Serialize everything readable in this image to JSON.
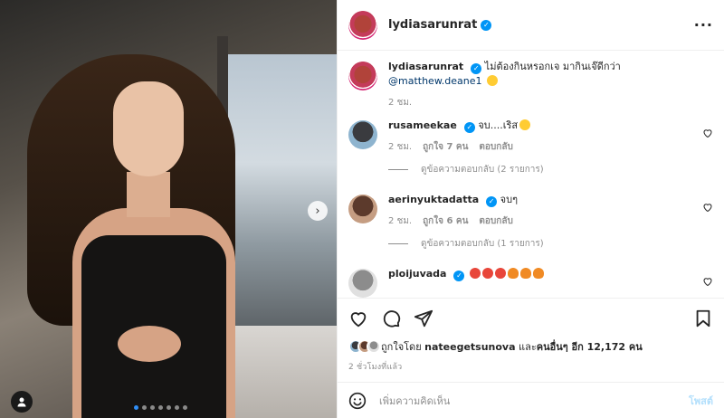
{
  "post": {
    "username": "lydiasarunrat",
    "caption": {
      "username": "lydiasarunrat",
      "text": "ไม่ต้องกินหรอกเจ มากินเจ๊ดีกว่า",
      "mention": "@matthew.deane1",
      "time": "2 ชม."
    },
    "comments": [
      {
        "username": "rusameekae",
        "text": "จบ....เริส",
        "time": "2 ชม.",
        "likes": "ถูกใจ 7 คน",
        "reply_label": "ตอบกลับ",
        "view_replies": "ดูข้อความตอบกลับ (2 รายการ)"
      },
      {
        "username": "aerinyuktadatta",
        "text": "จบๆ",
        "time": "2 ชม.",
        "likes": "ถูกใจ 6 คน",
        "reply_label": "ตอบกลับ",
        "view_replies": "ดูข้อความตอบกลับ (1 รายการ)"
      },
      {
        "username": "ploijuvada",
        "text": ""
      }
    ],
    "liked_by": {
      "prefix": "ถูกใจโดย",
      "user": "nateegetsunova",
      "middle": "และ",
      "others": "คนอื่นๆ อีก 12,172 คน"
    },
    "timestamp": "2 ชั่วโมงที่แล้ว",
    "add_comment_placeholder": "เพิ่มความคิดเห็น",
    "post_button": "โพสต์"
  },
  "icons": {
    "more": "more-options-icon",
    "like": "heart-icon",
    "comment": "comment-icon",
    "share": "send-icon",
    "save": "bookmark-icon",
    "emoji": "emoji-icon",
    "next": "chevron-right-icon",
    "tag": "user-tag-icon"
  },
  "colors": {
    "verified": "#0095f6",
    "mention": "#00376b",
    "muted": "#8e8e8e",
    "post_button": "#b2dffc",
    "active_dot": "#2f8ef6"
  },
  "carousel": {
    "total": 7,
    "active": 1
  }
}
